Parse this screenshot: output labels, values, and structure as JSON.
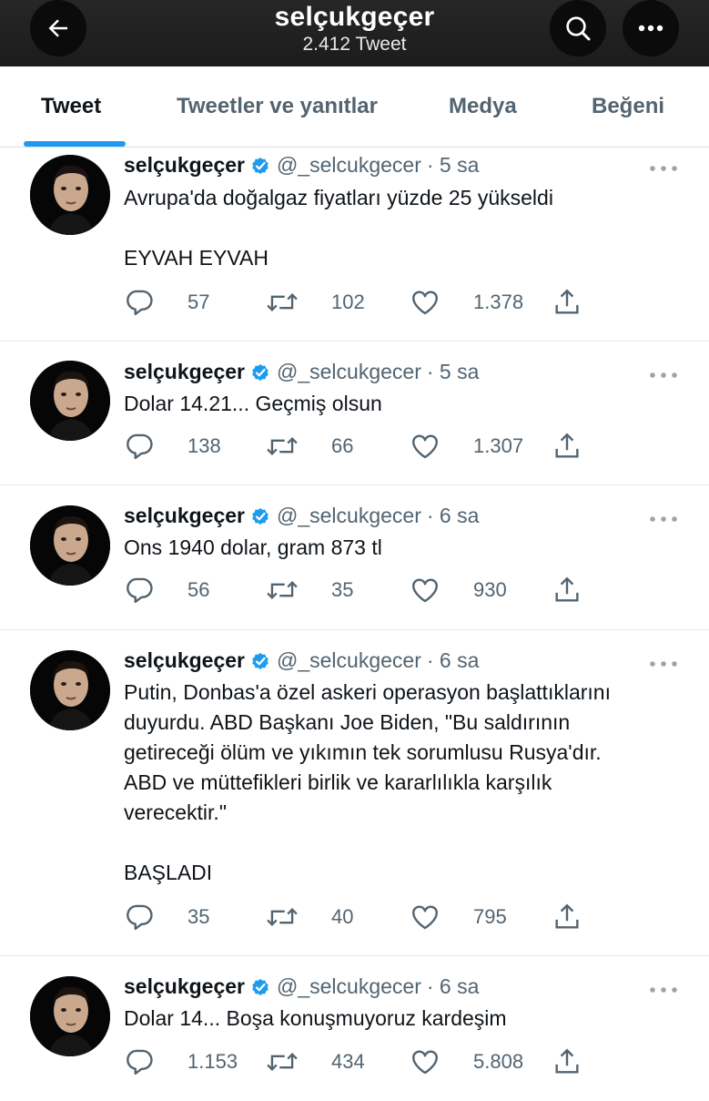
{
  "header": {
    "title": "selçukgeçer",
    "subtitle": "2.412 Tweet"
  },
  "tabs": [
    {
      "label": "Tweet"
    },
    {
      "label": "Tweetler ve yanıtlar"
    },
    {
      "label": "Medya"
    },
    {
      "label": "Beğeni"
    }
  ],
  "colors": {
    "accent": "#1d9bf0",
    "header_bg": "#222222",
    "muted": "#536471"
  },
  "tweets": [
    {
      "name": "selçukgeçer",
      "handle": "@_selcukgecer",
      "time": "· 5 sa",
      "text": "Avrupa'da doğalgaz fiyatları yüzde 25 yükseldi\n\nEYVAH EYVAH",
      "replies": "57",
      "retweets": "102",
      "likes": "1.378"
    },
    {
      "name": "selçukgeçer",
      "handle": "@_selcukgecer",
      "time": "· 5 sa",
      "text": "Dolar 14.21... Geçmiş olsun",
      "replies": "138",
      "retweets": "66",
      "likes": "1.307"
    },
    {
      "name": "selçukgeçer",
      "handle": "@_selcukgecer",
      "time": "· 6 sa",
      "text": "Ons 1940 dolar, gram 873 tl",
      "replies": "56",
      "retweets": "35",
      "likes": "930"
    },
    {
      "name": "selçukgeçer",
      "handle": "@_selcukgecer",
      "time": "· 6 sa",
      "text": "Putin, Donbas'a özel askeri operasyon başlattıklarını\nduyurdu. ABD Başkanı Joe Biden, \"Bu saldırının\ngetireceği ölüm ve yıkımın tek sorumlusu Rusya'dır.\nABD ve müttefikleri birlik ve kararlılıkla karşılık\nverecektir.\"\n\nBAŞLADI",
      "replies": "35",
      "retweets": "40",
      "likes": "795"
    },
    {
      "name": "selçukgeçer",
      "handle": "@_selcukgecer",
      "time": "· 6 sa",
      "text": "Dolar 14... Boşa konuşmuyoruz kardeşim",
      "replies": "1.153",
      "retweets": "434",
      "likes": "5.808"
    }
  ]
}
